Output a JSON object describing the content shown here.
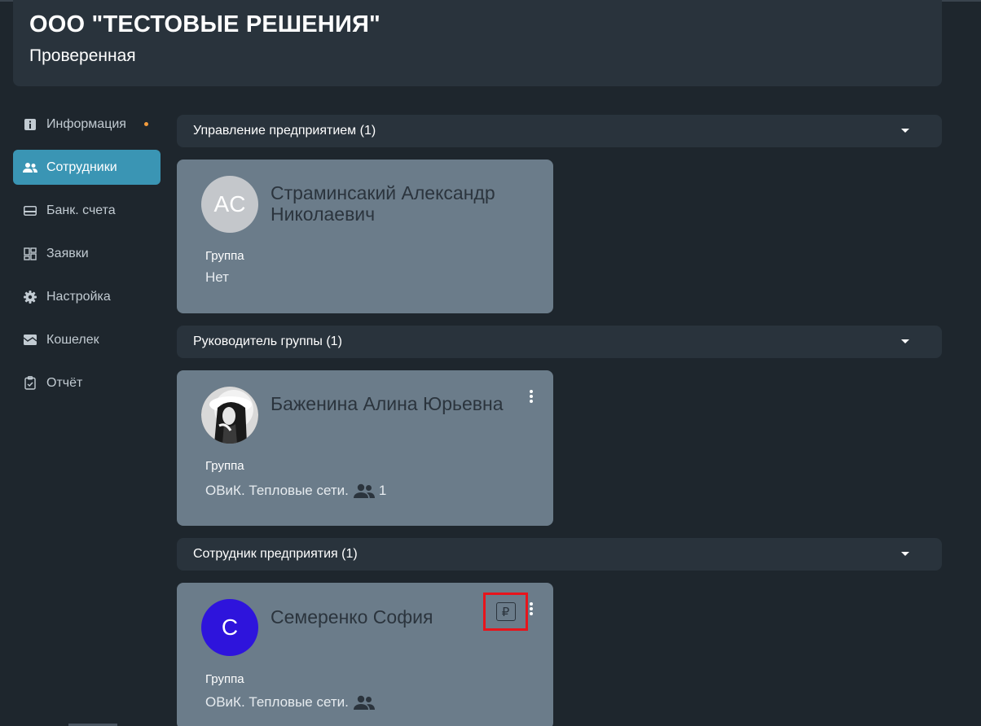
{
  "header": {
    "org_name": "ООО \"ТЕСТОВЫЕ РЕШЕНИЯ\"",
    "org_status": "Проверенная"
  },
  "sidebar": {
    "items": [
      {
        "label": "Информация",
        "icon": "info-icon",
        "has_dot": true,
        "active": false
      },
      {
        "label": "Сотрудники",
        "icon": "people-icon",
        "active": true
      },
      {
        "label": "Банк. счета",
        "icon": "bank-card-icon",
        "active": false
      },
      {
        "label": "Заявки",
        "icon": "dashboard-icon",
        "active": false
      },
      {
        "label": "Настройка",
        "icon": "gear-icon",
        "active": false
      },
      {
        "label": "Кошелек",
        "icon": "wallet-icon",
        "active": false
      },
      {
        "label": "Отчёт",
        "icon": "clipboard-check-icon",
        "active": false
      }
    ]
  },
  "sections": [
    {
      "title": "Управление предприятием (1)",
      "employee": {
        "initials": "AC",
        "name": "Страминсакий Александр Николаевич",
        "group_label": "Группа",
        "group_value": "Нет",
        "avatar_color": "#c4c7cb"
      }
    },
    {
      "title": "Руководитель группы (1)",
      "employee": {
        "name": "Баженина Алина Юрьевна",
        "group_label": "Группа",
        "group_value": "ОВиК. Тепловые сети.",
        "group_count": "1",
        "avatar": "photo-avatar"
      }
    },
    {
      "title": "Сотрудник предприятия (1)",
      "employee": {
        "initials": "С",
        "name": "Семеренко София",
        "group_label": "Группа",
        "group_value": "ОВиК. Тепловые сети.",
        "avatar_color": "#2e14dc",
        "ruble_symbol": "₽"
      }
    }
  ],
  "colors": {
    "accent": "#3a95b4",
    "card": "#6b7c8a",
    "highlight": "#e8141b",
    "notification_dot": "#f39c3d"
  }
}
